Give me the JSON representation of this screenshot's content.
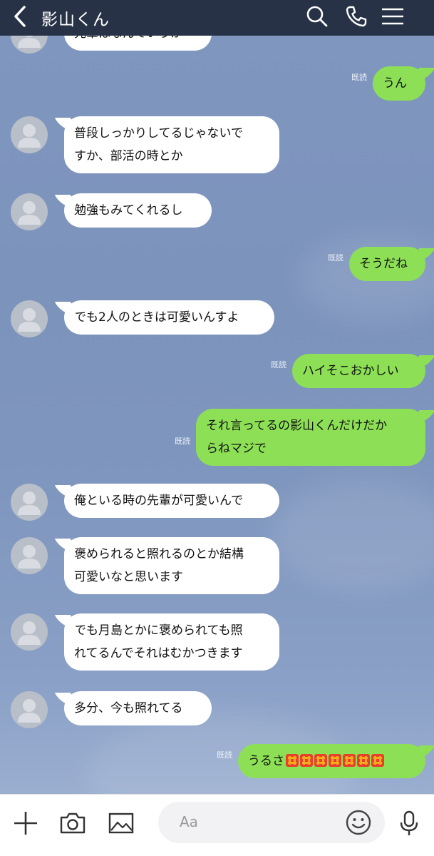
{
  "header": {
    "title": "影山くん",
    "icons": [
      "back-chevron-icon",
      "search-icon",
      "phone-icon",
      "menu-icon"
    ],
    "background": "#273246"
  },
  "colors": {
    "incoming_bubble": "#ffffff",
    "outgoing_bubble": "#8de055",
    "chat_background": "#7f96bf"
  },
  "messages": [
    {
      "side": "in",
      "lines": [
        "先輩はなんていうか"
      ]
    },
    {
      "side": "out",
      "read": "既読",
      "lines": [
        "うん"
      ]
    },
    {
      "side": "in",
      "lines": [
        "普段しっかりしてるじゃないで",
        "すか、部活の時とか"
      ]
    },
    {
      "side": "in",
      "lines": [
        "勉強もみてくれるし"
      ]
    },
    {
      "side": "out",
      "read": "既読",
      "lines": [
        "そうだね"
      ]
    },
    {
      "side": "in",
      "lines": [
        "でも2人のときは可愛いんすよ"
      ]
    },
    {
      "side": "out",
      "read": "既読",
      "lines": [
        "ハイそこおかしい"
      ]
    },
    {
      "side": "out",
      "read": "既読",
      "lines": [
        "それ言ってるの影山くんだけだか",
        "らねマジで"
      ]
    },
    {
      "side": "in",
      "lines": [
        "俺といる時の先輩が可愛いんで"
      ]
    },
    {
      "side": "in",
      "lines": [
        "褒められると照れるのとか結構",
        "可愛いなと思います"
      ]
    },
    {
      "side": "in",
      "lines": [
        "でも月島とかに褒められても照",
        "れてるんでそれはむかつきます"
      ]
    },
    {
      "side": "in",
      "lines": [
        "多分、今も照れてる"
      ]
    },
    {
      "side": "out",
      "read": "既読",
      "text": "うるさ",
      "emoji": "anger-symbol",
      "emoji_count": 7
    }
  ],
  "footer": {
    "input_placeholder": "Aa",
    "icons": [
      "plus-icon",
      "camera-icon",
      "image-icon",
      "smiley-icon",
      "microphone-icon"
    ]
  }
}
